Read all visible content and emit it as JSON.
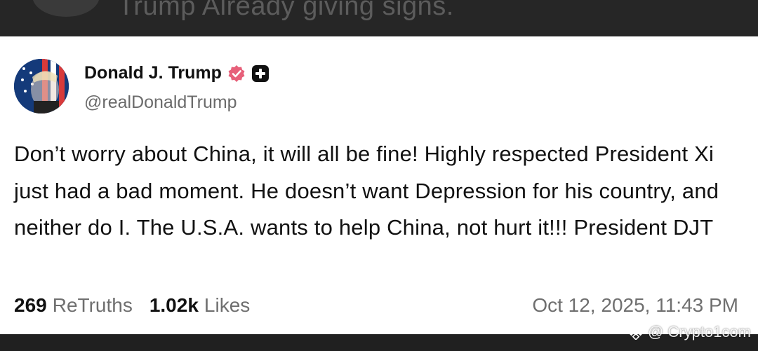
{
  "background_post": {
    "line1": "Trump Already giving signs.",
    "line2": ""
  },
  "post": {
    "author": {
      "display_name": "Donald J. Trump",
      "handle": "@realDonaldTrump",
      "avatar": "avatar-icon",
      "verified_badge": "verified-badge-icon",
      "plus_badge": "plus-badge-icon"
    },
    "body": "Don’t worry about China, it will all be fine! Highly respected President Xi just had a bad moment. He doesn’t want Depression for his country, and neither do I. The U.S.A. wants to help China, not hurt it!!!  President DJT",
    "retruths_count": "269",
    "retruths_label": "ReTruths",
    "likes_count": "1.02k",
    "likes_label": "Likes",
    "timestamp": "Oct 12, 2025, 11:43 PM"
  },
  "watermark": {
    "text": "@ Crypto1com",
    "icon": "binance-logo-icon"
  },
  "colors": {
    "verified_badge": "#e7607a",
    "text_primary": "#111111",
    "text_secondary": "#6b6b6b",
    "card_bg": "#ffffff",
    "frame_bg": "#232323"
  }
}
